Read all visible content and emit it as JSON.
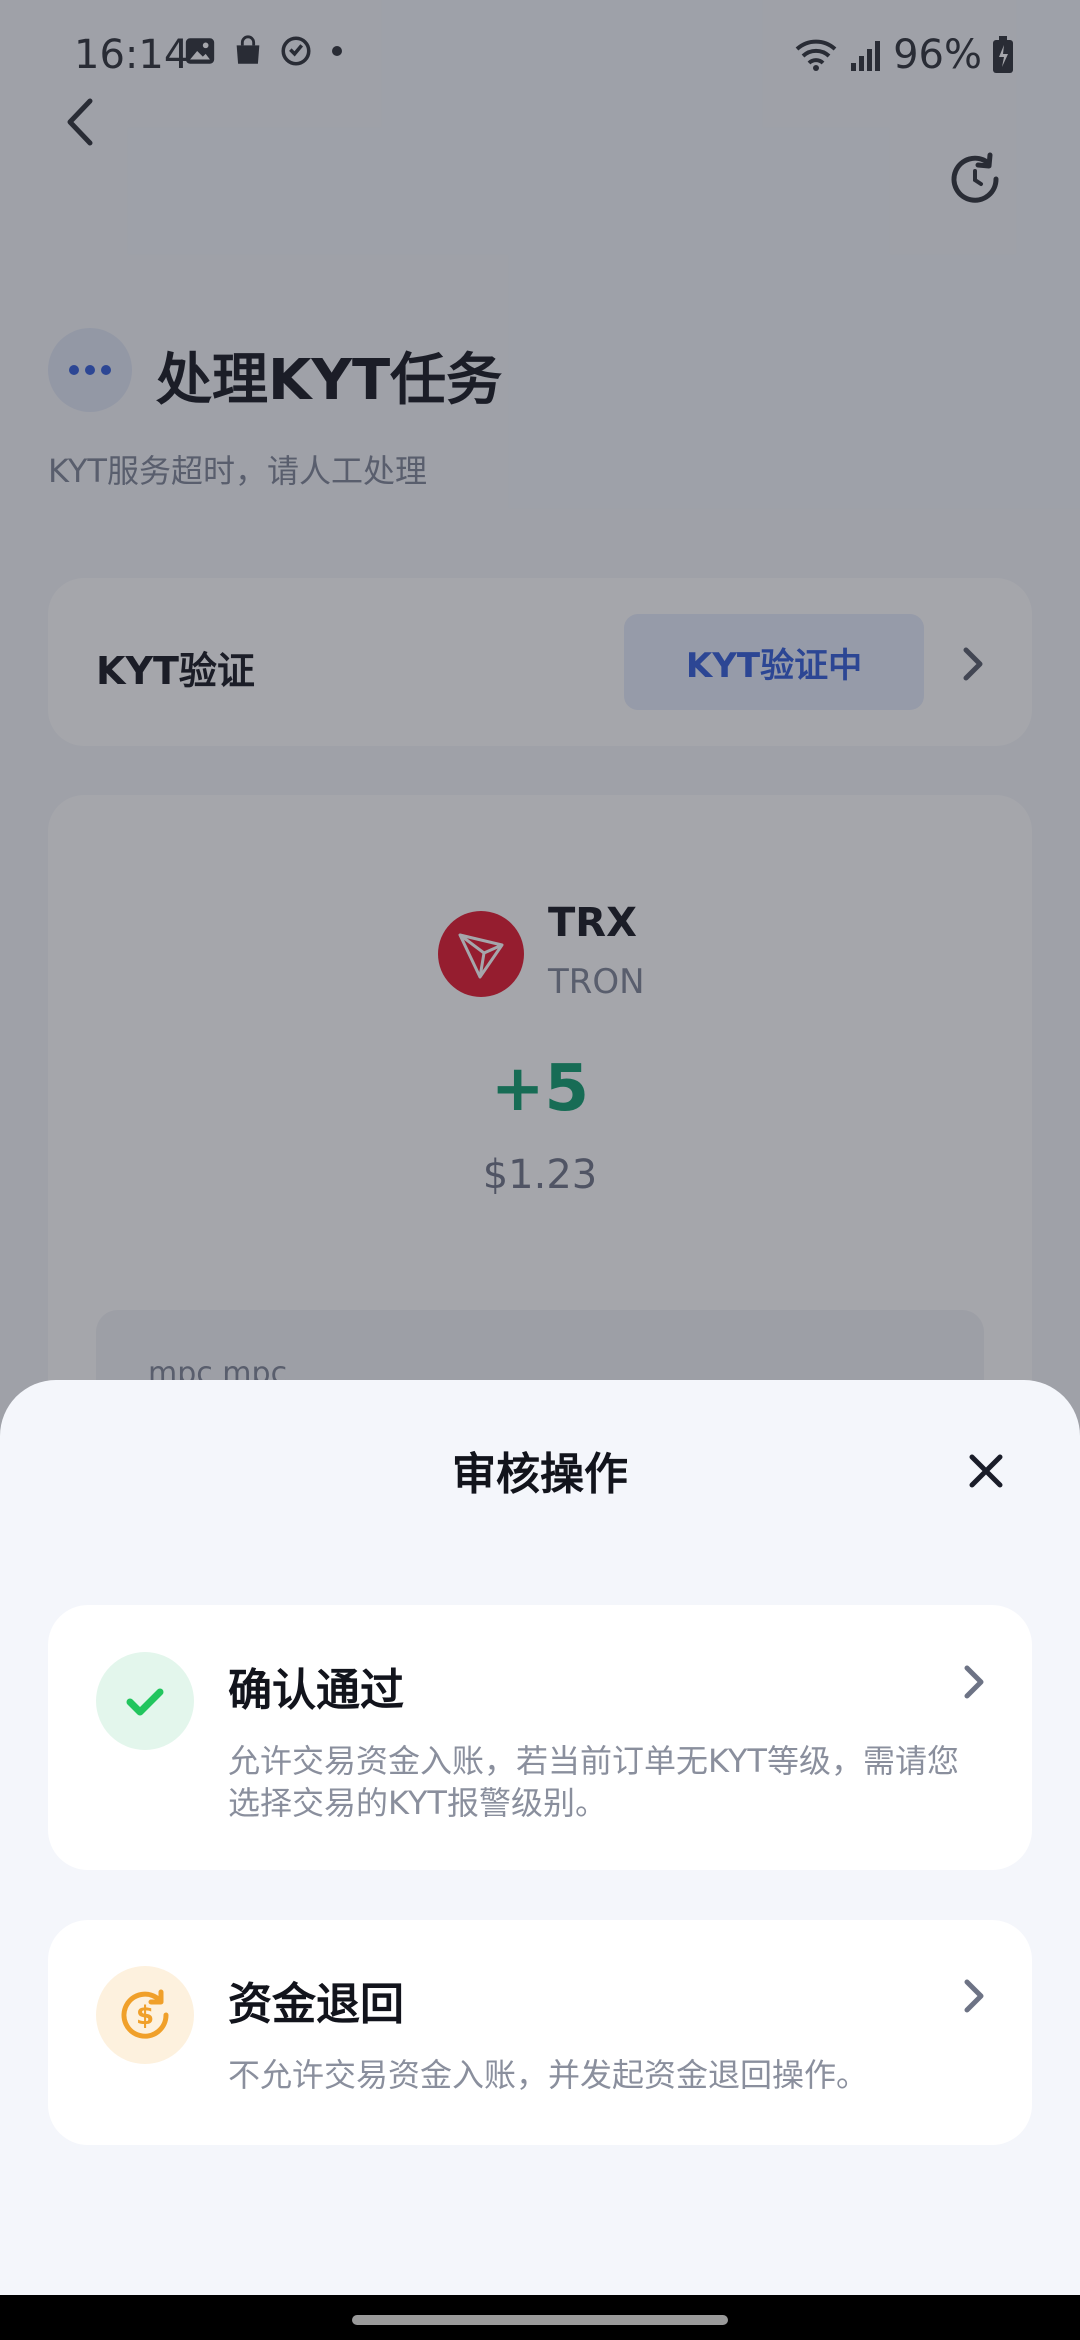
{
  "status_bar": {
    "time": "16:14",
    "battery": "96%"
  },
  "header": {
    "title": "处理KYT任务",
    "subtitle": "KYT服务超时，请人工处理"
  },
  "kyt": {
    "label": "KYT验证",
    "status": "KYT验证中"
  },
  "asset": {
    "symbol": "TRX",
    "network": "TRON",
    "amount": "+5",
    "usd_value": "$1.23",
    "detail_preview": "mpc   mpc"
  },
  "sheet": {
    "title": "审核操作",
    "options": [
      {
        "title": "确认通过",
        "description": "允许交易资金入账，若当前订单无KYT等级，需请您选择交易的KYT报警级别。",
        "icon": "check-icon"
      },
      {
        "title": "资金退回",
        "description": "不允许交易资金入账，并发起资金退回操作。",
        "icon": "refund-dollar-icon"
      }
    ]
  },
  "colors": {
    "accent": "#2f5bd8",
    "positive": "#0c9b6b",
    "tron_red": "#e3132a",
    "approve_green": "#22c55e",
    "refund_orange": "#f0a02a"
  }
}
